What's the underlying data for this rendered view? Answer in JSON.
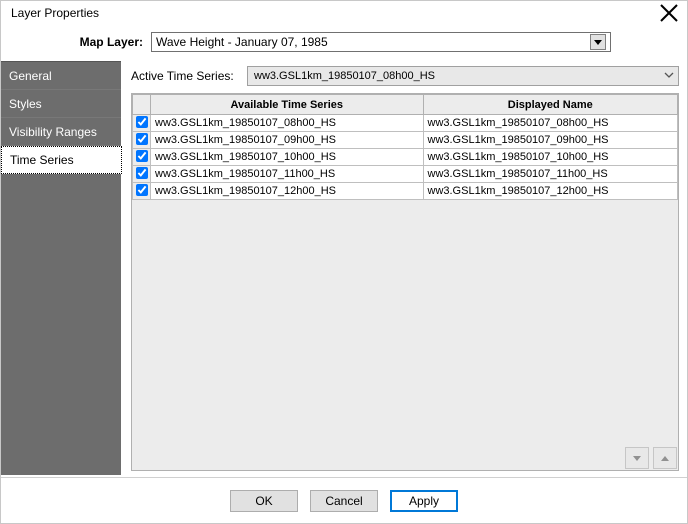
{
  "window": {
    "title": "Layer Properties"
  },
  "map_layer": {
    "label": "Map Layer:",
    "selected": "Wave Height - January 07, 1985"
  },
  "sidebar": {
    "tabs": [
      {
        "label": "General"
      },
      {
        "label": "Styles"
      },
      {
        "label": "Visibility Ranges"
      },
      {
        "label": "Time Series"
      }
    ],
    "active_index": 3
  },
  "active_time_series": {
    "label": "Active Time Series:",
    "selected": "ww3.GSL1km_19850107_08h00_HS"
  },
  "table": {
    "columns": {
      "available": "Available Time Series",
      "displayed": "Displayed Name"
    },
    "rows": [
      {
        "checked": true,
        "available": "ww3.GSL1km_19850107_08h00_HS",
        "displayed": "ww3.GSL1km_19850107_08h00_HS"
      },
      {
        "checked": true,
        "available": "ww3.GSL1km_19850107_09h00_HS",
        "displayed": "ww3.GSL1km_19850107_09h00_HS"
      },
      {
        "checked": true,
        "available": "ww3.GSL1km_19850107_10h00_HS",
        "displayed": "ww3.GSL1km_19850107_10h00_HS"
      },
      {
        "checked": true,
        "available": "ww3.GSL1km_19850107_11h00_HS",
        "displayed": "ww3.GSL1km_19850107_11h00_HS"
      },
      {
        "checked": true,
        "available": "ww3.GSL1km_19850107_12h00_HS",
        "displayed": "ww3.GSL1km_19850107_12h00_HS"
      }
    ]
  },
  "buttons": {
    "ok": "OK",
    "cancel": "Cancel",
    "apply": "Apply"
  }
}
